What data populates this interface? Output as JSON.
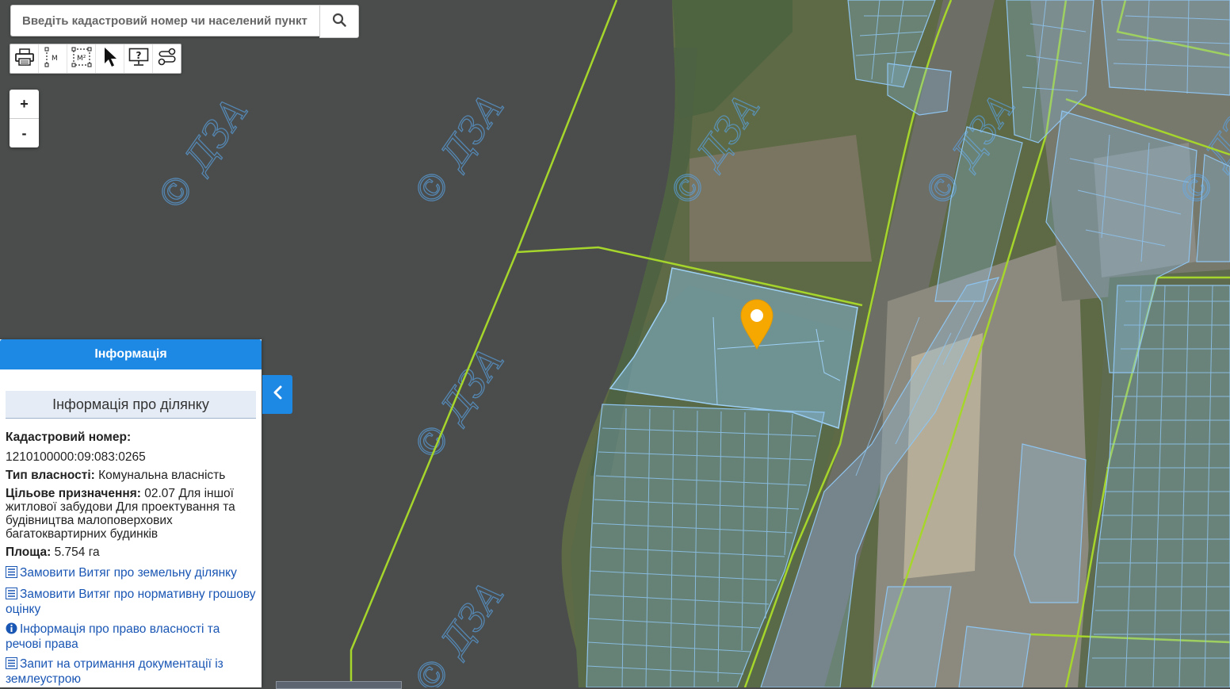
{
  "search": {
    "placeholder": "Введіть кадастровий номер чи населений пункт"
  },
  "toolbar": {
    "tools": [
      {
        "icon": "print-icon"
      },
      {
        "icon": "measure-distance-icon",
        "text": "M"
      },
      {
        "icon": "measure-area-icon",
        "text": "M²"
      },
      {
        "icon": "cursor-icon"
      },
      {
        "icon": "identify-help-icon"
      },
      {
        "icon": "route-icon"
      }
    ]
  },
  "zoom": {
    "in": "+",
    "out": "-"
  },
  "watermark": "© ДЗА",
  "panel": {
    "header": "Інформація",
    "section_title": "Інформація про ділянку",
    "cadastral_label": "Кадастровий номер:",
    "cadastral_value": "1210100000:09:083:0265",
    "ownership_label": "Тип власності:",
    "ownership_value": "Комунальна власність",
    "purpose_label": "Цільове призначення:",
    "purpose_value": "02.07 Для іншої житлової забудови Для проектування та будівництва малоповерхових багатоквартирних будинків",
    "area_label": "Площа:",
    "area_value": "5.754 га",
    "links": [
      "Замовити Витяг про земельну ділянку",
      "Замовити Витяг про нормативну грошову оцінку",
      "Інформація про право власності та речові права",
      "Запит на отримання документації із землеустрою"
    ]
  },
  "colors": {
    "accent": "#1e88e5",
    "parcel_stroke": "#7fb8ea",
    "boundary": "#a6d62b",
    "marker": "#f6a800",
    "water": "#4a4c4b"
  }
}
